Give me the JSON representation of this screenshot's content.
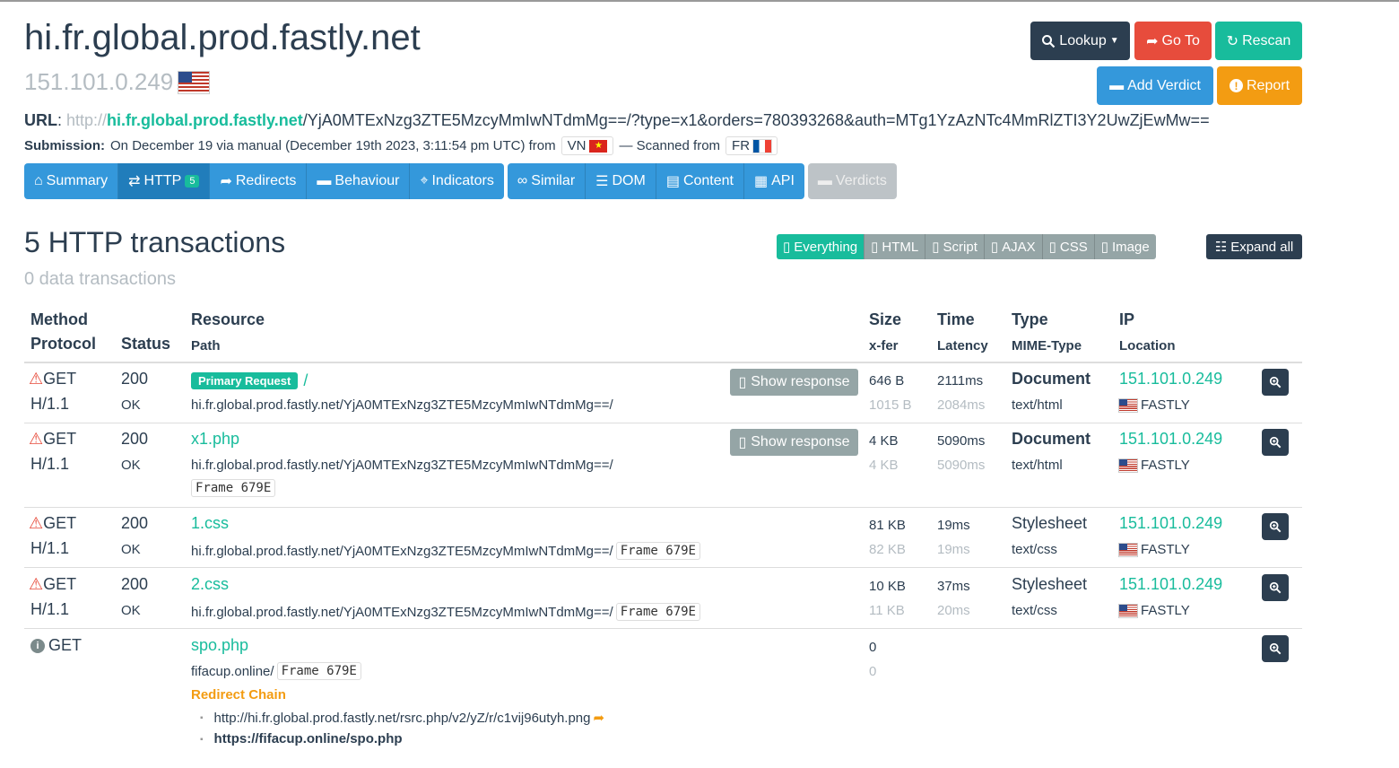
{
  "page": {
    "hostname": "hi.fr.global.prod.fastly.net",
    "ip": "151.101.0.249"
  },
  "buttons": {
    "lookup": "Lookup",
    "goto": "Go To",
    "rescan": "Rescan",
    "add_verdict": "Add Verdict",
    "report": "Report"
  },
  "url": {
    "label": "URL",
    "scheme": "http://",
    "host": "hi.fr.global.prod.fastly.net",
    "path": "/YjA0MTExNzg3ZTE5MzcyMmIwNTdmMg==/?type=x1&orders=780393268&auth=MTg1YzAzNTc4MmRlZTI3Y2UwZjEwMw=="
  },
  "submission": {
    "label": "Submission:",
    "text": "On December 19 via manual (December 19th 2023, 3:11:54 pm UTC) from",
    "from_country": "VN",
    "scanned_text": "— Scanned from",
    "scanned_country": "FR"
  },
  "tabs": [
    {
      "label": "Summary"
    },
    {
      "label": "HTTP",
      "badge": "5"
    },
    {
      "label": "Redirects"
    },
    {
      "label": "Behaviour"
    },
    {
      "label": "Indicators"
    },
    {
      "label": "Similar"
    },
    {
      "label": "DOM"
    },
    {
      "label": "Content"
    },
    {
      "label": "API"
    },
    {
      "label": "Verdicts"
    }
  ],
  "section": {
    "title": "5 HTTP transactions",
    "subtitle": "0 data transactions",
    "expand_all": "Expand all"
  },
  "filters": [
    "Everything",
    "HTML",
    "Script",
    "AJAX",
    "CSS",
    "Image"
  ],
  "table": {
    "headers": {
      "method": "Method",
      "protocol": "Protocol",
      "status": "Status",
      "resource": "Resource",
      "path": "Path",
      "size": "Size",
      "xfer": "x-fer",
      "time": "Time",
      "latency": "Latency",
      "type": "Type",
      "mime": "MIME-Type",
      "ip": "IP",
      "location": "Location"
    },
    "show_response": "Show response",
    "primary_label": "Primary Request",
    "rows": [
      {
        "method": "GET",
        "protocol": "H/1.1",
        "status": "200",
        "status_text": "OK",
        "resource": "/",
        "path": "hi.fr.global.prod.fastly.net/YjA0MTExNzg3ZTE5MzcyMmIwNTdmMg==/",
        "frame": "",
        "size": "646 B",
        "xfer": "1015 B",
        "time": "2111ms",
        "latency": "2084ms",
        "type": "Document",
        "mime": "text/html",
        "ip": "151.101.0.249",
        "location": "FASTLY"
      },
      {
        "method": "GET",
        "protocol": "H/1.1",
        "status": "200",
        "status_text": "OK",
        "resource": "x1.php",
        "path": "hi.fr.global.prod.fastly.net/YjA0MTExNzg3ZTE5MzcyMmIwNTdmMg==/",
        "frame": "Frame 679E",
        "size": "4 KB",
        "xfer": "4 KB",
        "time": "5090ms",
        "latency": "5090ms",
        "type": "Document",
        "mime": "text/html",
        "ip": "151.101.0.249",
        "location": "FASTLY"
      },
      {
        "method": "GET",
        "protocol": "H/1.1",
        "status": "200",
        "status_text": "OK",
        "resource": "1.css",
        "path": "hi.fr.global.prod.fastly.net/YjA0MTExNzg3ZTE5MzcyMmIwNTdmMg==/",
        "frame": "Frame 679E",
        "size": "81 KB",
        "xfer": "82 KB",
        "time": "19ms",
        "latency": "19ms",
        "type": "Stylesheet",
        "mime": "text/css",
        "ip": "151.101.0.249",
        "location": "FASTLY"
      },
      {
        "method": "GET",
        "protocol": "H/1.1",
        "status": "200",
        "status_text": "OK",
        "resource": "2.css",
        "path": "hi.fr.global.prod.fastly.net/YjA0MTExNzg3ZTE5MzcyMmIwNTdmMg==/",
        "frame": "Frame 679E",
        "size": "10 KB",
        "xfer": "11 KB",
        "time": "37ms",
        "latency": "20ms",
        "type": "Stylesheet",
        "mime": "text/css",
        "ip": "151.101.0.249",
        "location": "FASTLY"
      },
      {
        "method": "GET",
        "resource": "spo.php",
        "path": "fifacup.online/",
        "frame": "Frame 679E",
        "size": "0",
        "xfer": "0",
        "redirect_label": "Redirect Chain",
        "redirect_chain": [
          "http://hi.fr.global.prod.fastly.net/rsrc.php/v2/yZ/r/c1vij96utyh.png",
          "https://fifacup.online/spo.php"
        ]
      }
    ]
  },
  "colors": {
    "accent": "#18bc9c",
    "primary": "#3498db",
    "dark": "#2c3e50",
    "danger": "#e74c3c",
    "warning": "#f39c12",
    "muted": "#b4bcc2"
  }
}
